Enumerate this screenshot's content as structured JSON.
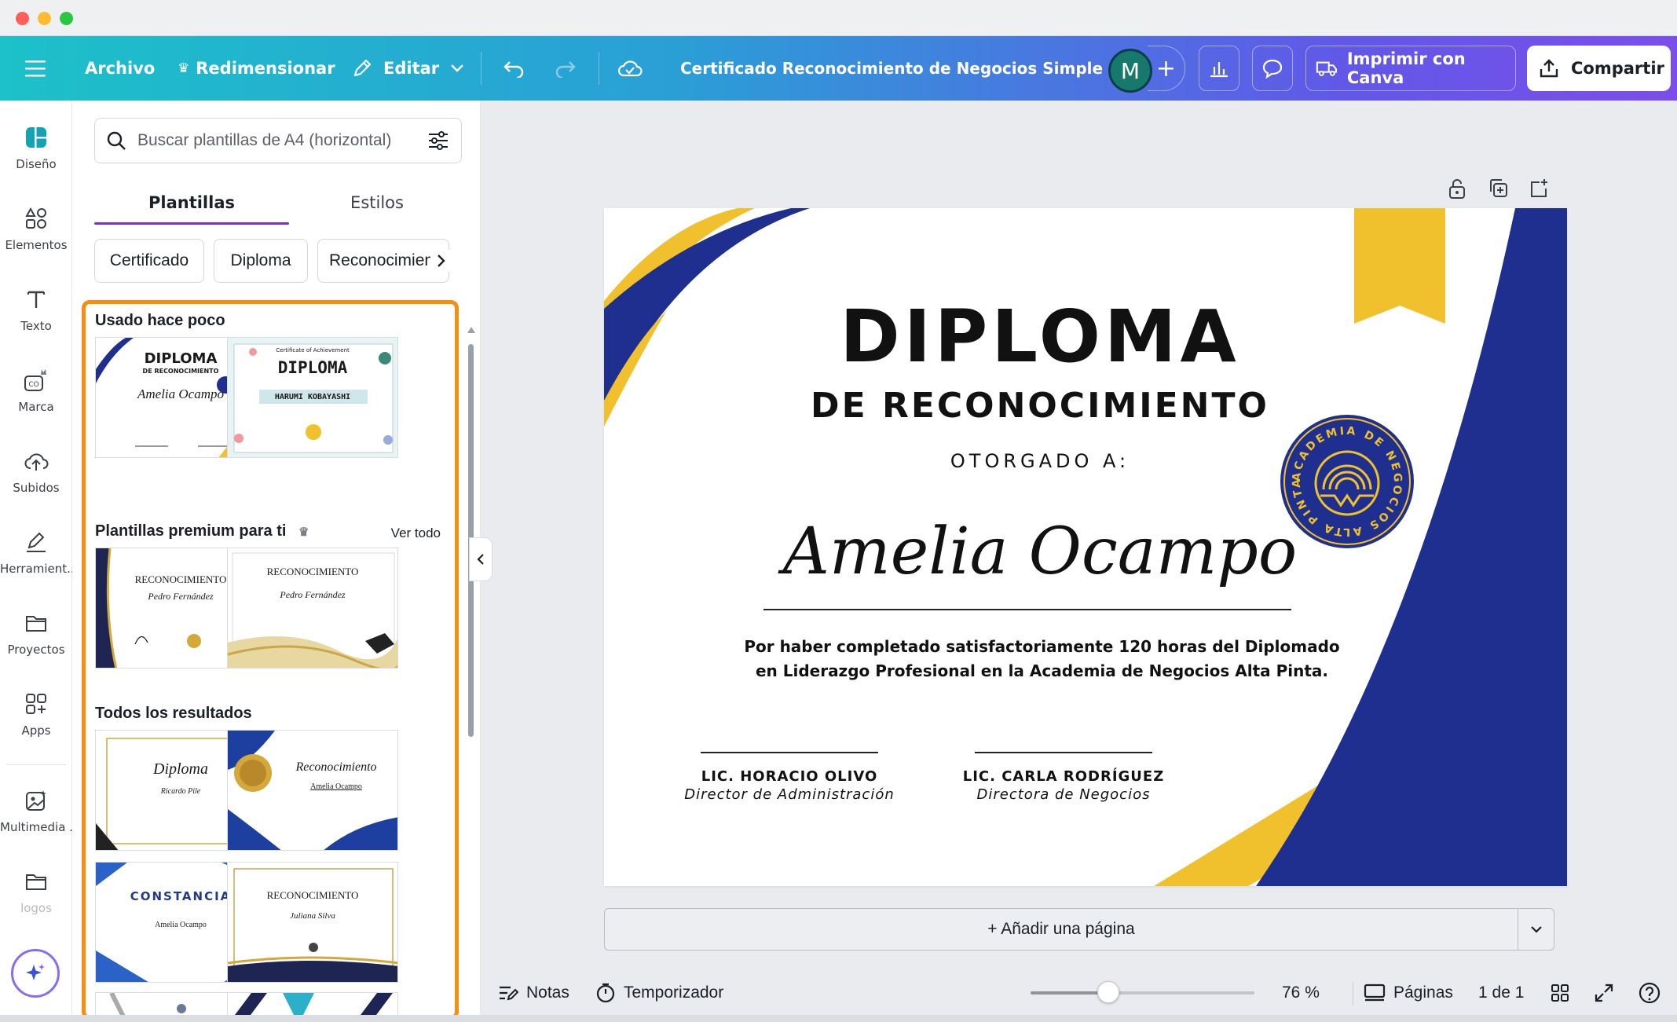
{
  "toolbar": {
    "menu_icon": "hamburger-icon",
    "file": "Archivo",
    "resize": "Redimensionar",
    "edit": "Editar",
    "doc_title": "Certificado Reconocimiento de Negocios Simple Az...",
    "avatar_letter": "M",
    "print": "Imprimir con Canva",
    "share": "Compartir"
  },
  "rail": {
    "items": [
      {
        "label": "Diseño",
        "icon": "design-icon"
      },
      {
        "label": "Elementos",
        "icon": "elements-icon"
      },
      {
        "label": "Texto",
        "icon": "text-icon"
      },
      {
        "label": "Marca",
        "icon": "brand-icon"
      },
      {
        "label": "Subidos",
        "icon": "upload-cloud-icon"
      },
      {
        "label": "Herramient...",
        "icon": "tools-icon"
      },
      {
        "label": "Proyectos",
        "icon": "folder-icon"
      },
      {
        "label": "Apps",
        "icon": "apps-icon"
      },
      {
        "label": "Multimedia ...",
        "icon": "media-icon"
      },
      {
        "label": "logos",
        "icon": "folder-icon"
      }
    ]
  },
  "panel": {
    "search_placeholder": "Buscar plantillas de A4 (horizontal)",
    "tabs": [
      "Plantillas",
      "Estilos"
    ],
    "chips": [
      "Certificado",
      "Diploma",
      "Reconocimien"
    ],
    "recent_title": "Usado hace poco",
    "premium_title": "Plantillas premium para ti",
    "see_all": "Ver todo",
    "all_title": "Todos los resultados",
    "thumbs": {
      "t1": {
        "title": "DIPLOMA",
        "sub": "DE RECONOCIMIENTO",
        "name": "Amelia Ocampo"
      },
      "t2": {
        "title": "DIPLOMA",
        "sub": "Certificate of Achievement",
        "name": "HARUMI KOBAYASHI"
      },
      "t3": {
        "title": "RECONOCIMIENTO",
        "name": "Pedro Fernández"
      },
      "t4": {
        "title": "RECONOCIMIENTO",
        "name": "Pedro Fernández"
      },
      "t5": {
        "title": "Diploma",
        "name": "Ricardo Pile"
      },
      "t6": {
        "title": "Reconocimiento",
        "name": "Amelia Ocampo"
      },
      "t7": {
        "title": "CONSTANCIA",
        "name": "Amelia Ocampo"
      },
      "t8": {
        "title": "RECONOCIMIENTO",
        "name": "Juliana Silva"
      }
    }
  },
  "certificate": {
    "title": "DIPLOMA",
    "subtitle": "DE RECONOCIMIENTO",
    "awarded": "OTORGADO A:",
    "name": "Amelia Ocampo",
    "text_line1": "Por haber completado satisfactoriamente 120 horas del Diplomado",
    "text_line2": "en Liderazgo Profesional en la Academia de Negocios Alta Pinta.",
    "sig1_name": "LIC. HORACIO OLIVO",
    "sig1_role": "Director de Administración",
    "sig2_name": "LIC. CARLA RODRÍGUEZ",
    "sig2_role": "Directora de Negocios",
    "seal_text": "ACADEMIA DE NEGOCIOS ALTA PINTA",
    "colors": {
      "navy": "#1f2f8f",
      "gold": "#f0c12c"
    }
  },
  "add_page": "+ Añadir una página",
  "bottom": {
    "notes": "Notas",
    "timer": "Temporizador",
    "zoom": "76 %",
    "zoom_value": 0.76,
    "pages": "Páginas",
    "page_count": "1 de 1"
  }
}
